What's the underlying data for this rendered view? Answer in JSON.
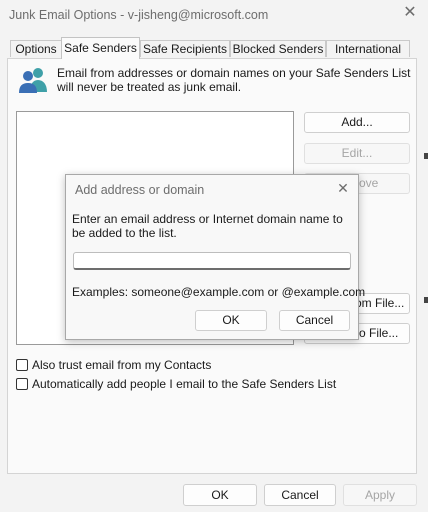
{
  "window": {
    "title": "Junk Email Options - v-jisheng@microsoft.com",
    "close_glyph": "✕"
  },
  "tabs": [
    {
      "label": "Options",
      "active": false
    },
    {
      "label": "Safe Senders",
      "active": true
    },
    {
      "label": "Safe Recipients",
      "active": false
    },
    {
      "label": "Blocked Senders",
      "active": false
    },
    {
      "label": "International",
      "active": false
    }
  ],
  "safe_senders": {
    "info_icon": "people-icon",
    "info_text": "Email from addresses or domain names on your Safe Senders List will never be treated as junk email.",
    "list_items": [],
    "buttons": {
      "add": "Add...",
      "edit": "Edit...",
      "remove_partial": "ove",
      "import_partial": "om File...",
      "export_partial": "o File..."
    },
    "trust_contacts_label": "Also trust email from my Contacts",
    "auto_add_label": "Automatically add people I email to the Safe Senders List"
  },
  "footer": {
    "ok": "OK",
    "cancel": "Cancel",
    "apply": "Apply"
  },
  "dialog": {
    "title": "Add address or domain",
    "close_glyph": "✕",
    "prompt": "Enter an email address or Internet domain name to be added to the list.",
    "input_value": "",
    "examples": "Examples: someone@example.com or @example.com",
    "ok": "OK",
    "cancel": "Cancel"
  },
  "colors": {
    "background": "#f3f3f3",
    "panel": "#fafafa",
    "icon_blue": "#3a6fb5",
    "icon_teal": "#3fa0a8"
  }
}
